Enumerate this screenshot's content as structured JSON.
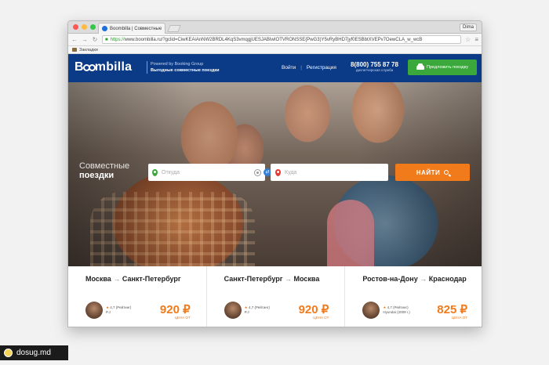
{
  "browser": {
    "tab_title": "Boombilla | Совместные",
    "profile": "Dima",
    "url_scheme": "https://",
    "url_rest": "www.boombilla.ru/?gclid=CiwKEAiAnNW2BRDL4KqS3vmqgjUESJABIwIOTVRONSSE{PwG3)Y5vRyBHD7jyf0ESBbtXVEPv7OewCLA_w_wcB",
    "bookmarks_label": "Закладки",
    "accent_colors": {
      "close": "#fc5753",
      "min": "#fdbc40",
      "max": "#33c748"
    }
  },
  "site": {
    "logo": {
      "pre": "B",
      "post": "mbilla"
    },
    "powered": "Powered by Booking Group",
    "slogan": "Выгодные совместные поездки",
    "nav": {
      "login": "Войти",
      "sep": "|",
      "register": "Регистрация"
    },
    "phone": "8(800) 755 87 78",
    "phone_sub": "диспетчерская служба",
    "offer_button": "Предложить поездку",
    "colors": {
      "header": "#0b3a86",
      "accent": "#f17a1b",
      "green": "#3aa83a"
    }
  },
  "hero": {
    "title_line1": "Совместные",
    "title_line2": "поездки",
    "from_placeholder": "Откуда",
    "to_placeholder": "Куда",
    "search_button": "НАЙТИ"
  },
  "routes": [
    {
      "title": "Москва",
      "title2": "Санкт-Петербург",
      "rating": "4,7 (Рейтинг)",
      "car": "P.J",
      "price": "920 ₽",
      "price_label": "цена от"
    },
    {
      "title": "Санкт-Петербург",
      "title2": "Москва",
      "rating": "4,7 (Рейтинг)",
      "car": "P.J",
      "price": "920 ₽",
      "price_label": "цена от"
    },
    {
      "title": "Ростов-на-Дону",
      "title2": "Краснодар",
      "rating": "4,7 (Рейтинг)",
      "car": "Hyundai (2009 г.)",
      "price": "825 ₽",
      "price_label": "цена от"
    }
  ],
  "route_arrow": "→",
  "watermark": "dosug.md"
}
